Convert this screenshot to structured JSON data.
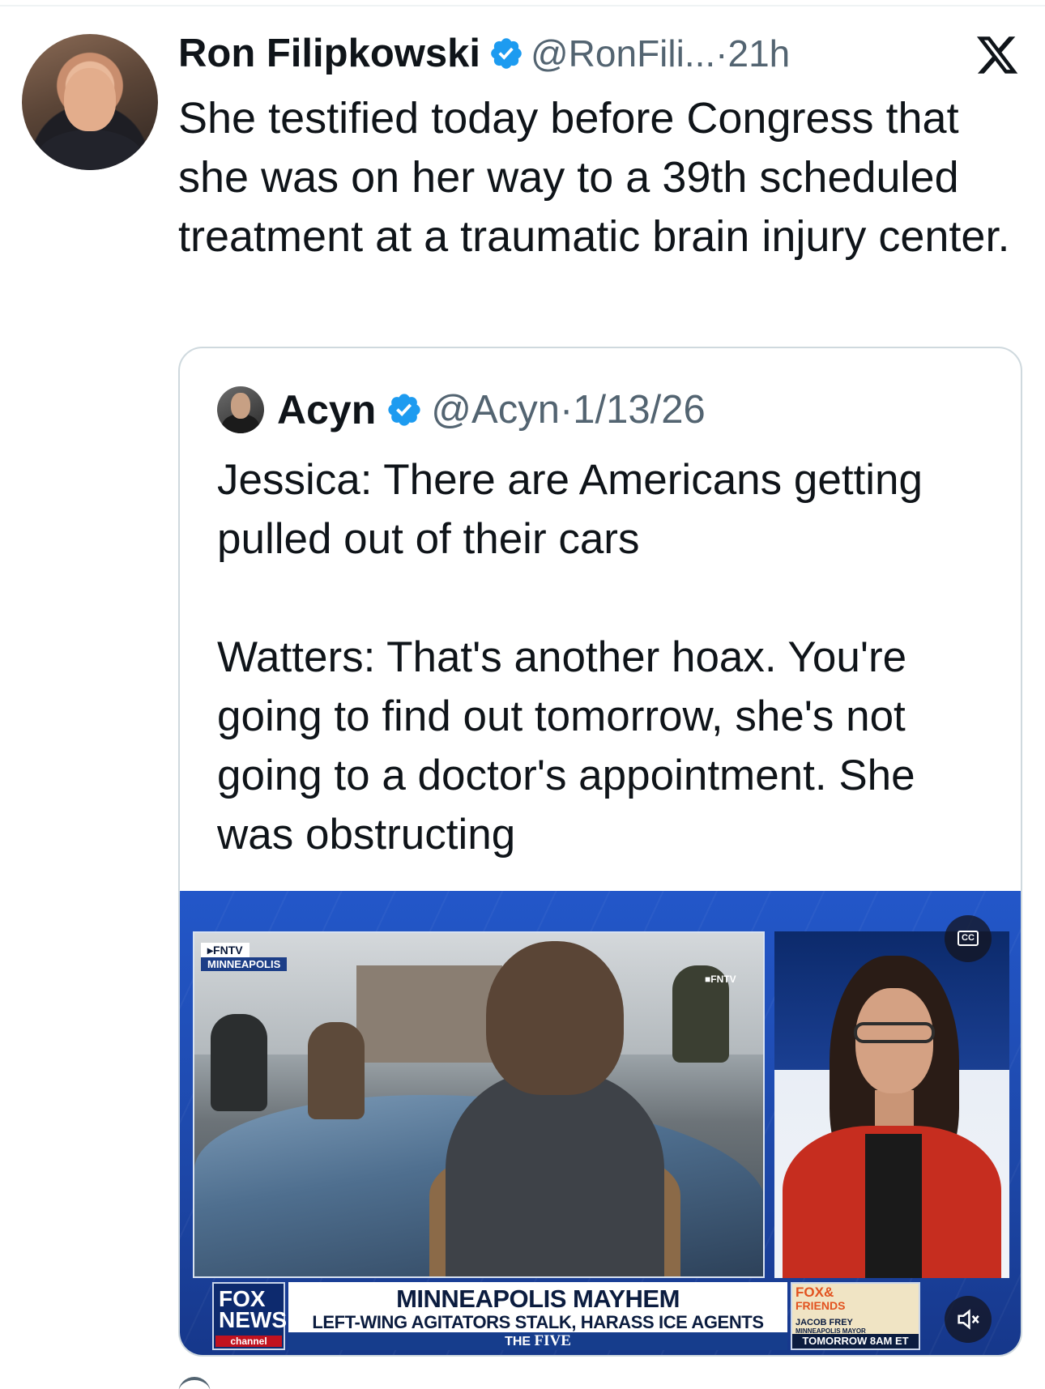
{
  "post": {
    "author_name": "Ron Filipkowski",
    "author_handle": "@RonFili...",
    "separator": "·",
    "time": "21h",
    "text": "She testified today before Congress that she was on her way to a 39th scheduled treatment at a traumatic brain injury center.",
    "platform_icon": "x-logo-icon",
    "verified_color": "#1d9bf0"
  },
  "quoted": {
    "author_name": "Acyn",
    "author_handle": "@Acyn",
    "separator": "·",
    "date": "1/13/26",
    "text": "Jessica: There are Americans getting pulled out of their cars\n\nWatters: That's another hoax. You're going to find out tomorrow, she's not going to a doctor's appointment. She was obstructing",
    "video": {
      "source_tag": "▸FNTV",
      "location_tag": "MINNEAPOLIS",
      "bug": "■FNTV",
      "cc_label": "CC",
      "network_logo_top": "FOX",
      "network_logo_bottom": "NEWS",
      "network_channel": "channel",
      "headline": "MINNEAPOLIS MAYHEM",
      "subheadline": "LEFT-WING AGITATORS STALK, HARASS ICE AGENTS",
      "show_prefix": "THE",
      "show_name": "FIVE",
      "promo_brand_top": "FOX&",
      "promo_brand_bottom": "FRIENDS",
      "promo_guest": "JACOB FREY",
      "promo_guest_title": "MINNEAPOLIS MAYOR",
      "promo_time": "TOMORROW 8AM ET",
      "mute_icon": "speaker-muted-icon"
    }
  }
}
